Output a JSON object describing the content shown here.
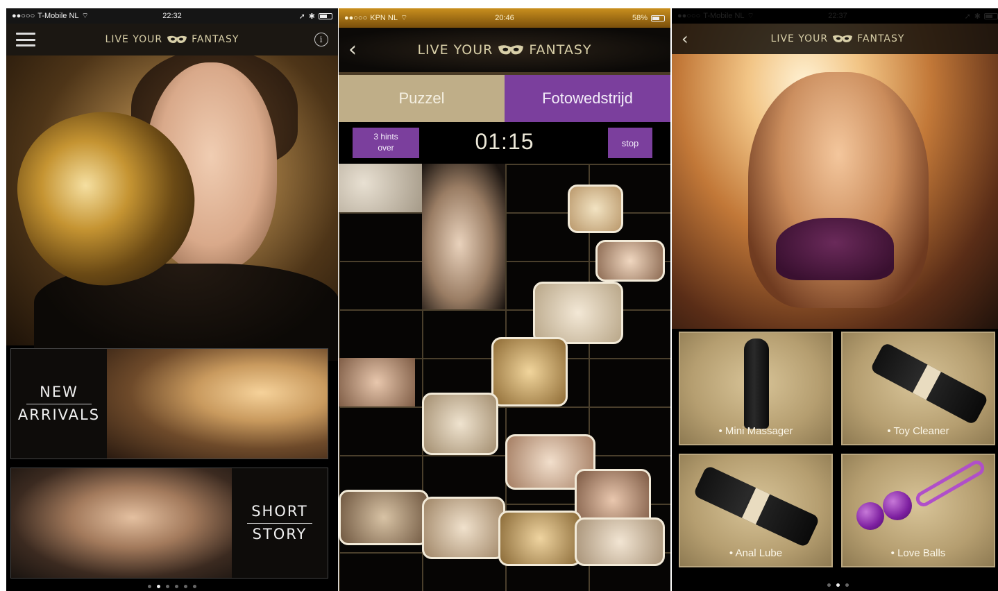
{
  "screen1": {
    "status": {
      "carrier": "T-Mobile NL",
      "time": "22:32"
    },
    "nav": {
      "brand_left": "LIVE YOUR",
      "brand_right": "FANTASY"
    },
    "promo_new": {
      "line1": "NEW",
      "line2": "ARRIVALS"
    },
    "promo_story": {
      "line1": "SHORT",
      "line2": "STORY"
    }
  },
  "screen2": {
    "status": {
      "carrier": "KPN NL",
      "time": "20:46",
      "battery": "58%"
    },
    "nav": {
      "brand_left": "LIVE YOUR",
      "brand_right": "FANTASY"
    },
    "tabs": [
      {
        "label": "Puzzel"
      },
      {
        "label": "Fotowedstrijd"
      }
    ],
    "hints": {
      "line1": "3 hints",
      "line2": "over"
    },
    "timer": "01:15",
    "stop_label": "stop"
  },
  "screen3": {
    "status": {
      "carrier": "T-Mobile NL",
      "time": "22:37"
    },
    "nav": {
      "brand_left": "LIVE YOUR",
      "brand_right": "FANTASY"
    },
    "products": [
      {
        "label": "• Mini Massager"
      },
      {
        "label": "• Toy Cleaner"
      },
      {
        "label": "• Anal Lube"
      },
      {
        "label": "• Love Balls"
      }
    ]
  },
  "colors": {
    "accent_purple": "#7b3f9d",
    "tab_beige": "#bfae88",
    "brand_gold": "#d8cfa8"
  }
}
